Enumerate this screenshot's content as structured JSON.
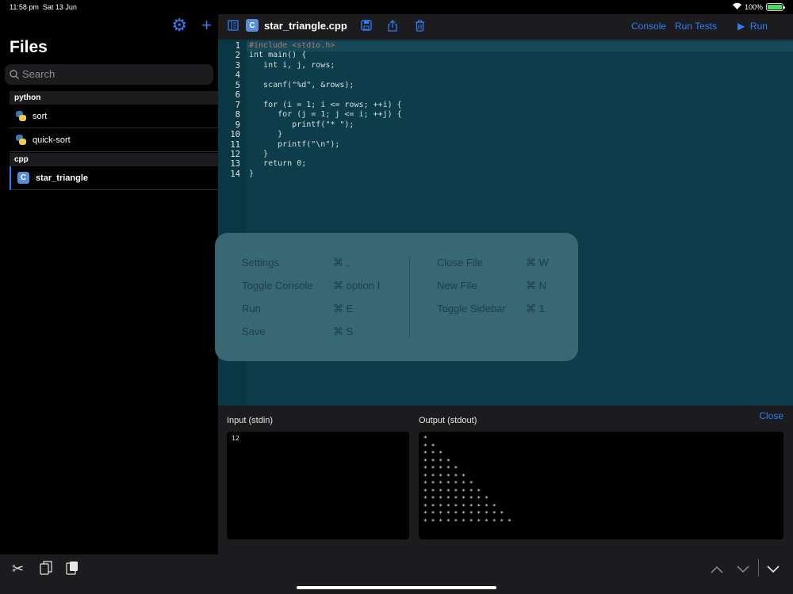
{
  "status_bar": {
    "time": "11:58 pm",
    "date": "Sat 13 Jun",
    "battery": "100%",
    "battery_level": 1.0
  },
  "sidebar": {
    "title": "Files",
    "search_placeholder": "Search",
    "groups": [
      {
        "name": "python",
        "files": [
          "sort",
          "quick-sort"
        ]
      },
      {
        "name": "cpp",
        "files": [
          "star_triangle"
        ]
      }
    ]
  },
  "toolbar": {
    "filename": "star_triangle.cpp",
    "console_label": "Console",
    "run_tests_label": "Run Tests",
    "run_label": "Run"
  },
  "editor": {
    "line_numbers": [
      "1",
      "2",
      "3",
      "4",
      "5",
      "6",
      "7",
      "8",
      "9",
      "10",
      "11",
      "12",
      "13",
      "14"
    ],
    "lines": [
      "#include <stdio.h>",
      "int main() {",
      "   int i, j, rows;",
      "",
      "   scanf(\"%d\", &rows);",
      "",
      "   for (i = 1; i <= rows; ++i) {",
      "      for (j = 1; j <= i; ++j) {",
      "         printf(\"* \");",
      "      }",
      "      printf(\"\\n\");",
      "   }",
      "   return 0;",
      "}"
    ]
  },
  "shortcuts": {
    "left": [
      {
        "label": "Settings",
        "key": "⌘ ,"
      },
      {
        "label": "Toggle Console",
        "key": "⌘ option I"
      },
      {
        "label": "Run",
        "key": "⌘ E"
      },
      {
        "label": "Save",
        "key": "⌘ S"
      }
    ],
    "right": [
      {
        "label": "Close File",
        "key": "⌘ W"
      },
      {
        "label": "New File",
        "key": "⌘ N"
      },
      {
        "label": "Toggle Sidebar",
        "key": "⌘ 1"
      }
    ]
  },
  "console": {
    "input_label": "Input (stdin)",
    "output_label": "Output (stdout)",
    "close_label": "Close",
    "input_value": "12",
    "output_value": "*\n* *\n* * *\n* * * *\n* * * * *\n* * * * * *\n* * * * * * *\n* * * * * * * *\n* * * * * * * * *\n* * * * * * * * * *\n* * * * * * * * * * *\n* * * * * * * * * * * *"
  },
  "colors": {
    "accent": "#2f7cf6",
    "editor_bg": "#0d3d4a",
    "overlay_bg": "#3a6a76"
  }
}
